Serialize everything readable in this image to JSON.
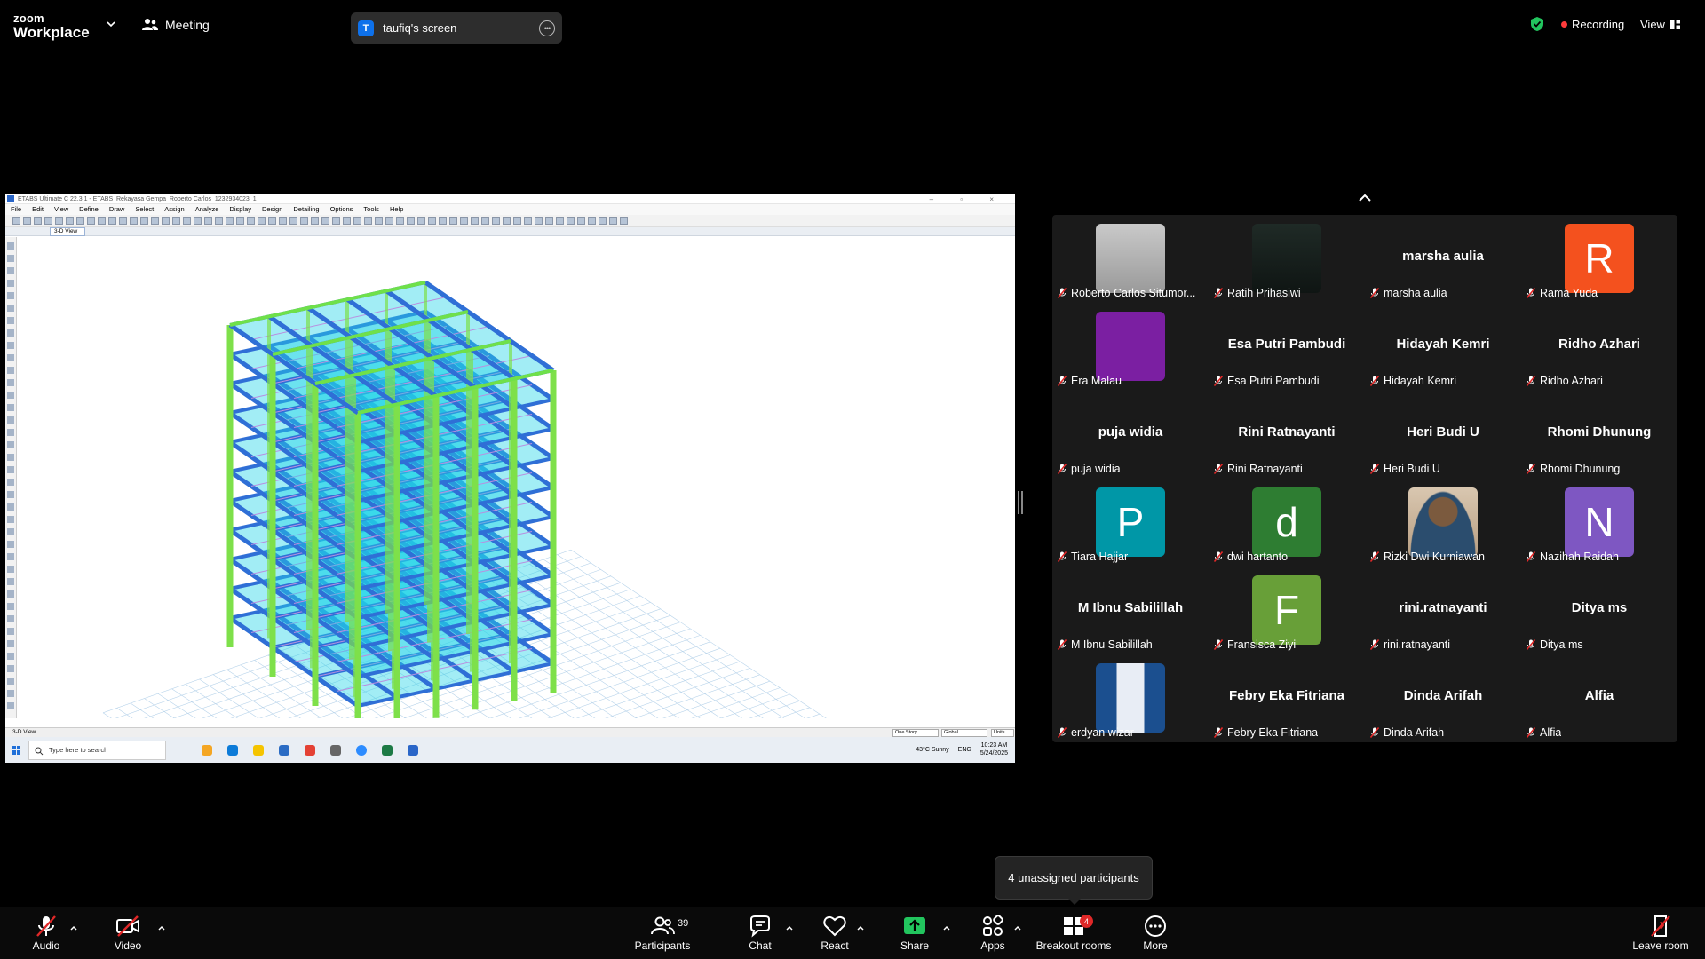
{
  "app": {
    "brand_top": "zoom",
    "brand_bottom": "Workplace",
    "meeting_label": "Meeting",
    "screen_share_initial": "T",
    "screen_share_label": "taufiq's screen",
    "recording_label": "Recording",
    "view_label": "View",
    "colors": {
      "accent": "#0e71eb",
      "recording_dot": "#ff3b3b",
      "shield": "#22c55e",
      "share_green": "#22c55e",
      "badge": "#e02828"
    }
  },
  "shared_screen": {
    "window_title": "ETABS Ultimate C 22.3.1 - ETABS_Rekayasa Gempa_Roberto Carlos_1232934023_1",
    "menu": [
      "File",
      "Edit",
      "View",
      "Define",
      "Draw",
      "Select",
      "Assign",
      "Analyze",
      "Display",
      "Design",
      "Detailing",
      "Options",
      "Tools",
      "Help"
    ],
    "view_tab": "3-D View",
    "status_left": "3-D View",
    "status_story": "One Story",
    "status_global": "Global",
    "status_units": "Units",
    "taskbar_search": "Type here to search",
    "weather": "43°C  Sunny",
    "lang": "ENG",
    "time": "10:23 AM",
    "date": "5/24/2025"
  },
  "participants": [
    {
      "name": "Roberto Carlos Situmor...",
      "big": "",
      "avatar": "photo-gray"
    },
    {
      "name": "Ratih Prihasiwi",
      "big": "",
      "avatar": "photo-dark"
    },
    {
      "name": "marsha aulia",
      "big": "marsha aulia",
      "avatar": ""
    },
    {
      "name": "Rama Yuda",
      "big": "R",
      "avatar": "#f4511e"
    },
    {
      "name": "Era Malau",
      "big": "",
      "avatar": "#7b1fa2"
    },
    {
      "name": "Esa Putri Pambudi",
      "big": "Esa Putri Pambudi",
      "avatar": ""
    },
    {
      "name": "Hidayah Kemri",
      "big": "Hidayah Kemri",
      "avatar": ""
    },
    {
      "name": "Ridho Azhari",
      "big": "Ridho Azhari",
      "avatar": ""
    },
    {
      "name": "puja widia",
      "big": "puja widia",
      "avatar": ""
    },
    {
      "name": "Rini Ratnayanti",
      "big": "Rini Ratnayanti",
      "avatar": ""
    },
    {
      "name": "Heri Budi U",
      "big": "Heri Budi U",
      "avatar": ""
    },
    {
      "name": "Rhomi Dhunung",
      "big": "Rhomi Dhunung",
      "avatar": ""
    },
    {
      "name": "Tiara Hajjar",
      "big": "P",
      "avatar": "#0097a7"
    },
    {
      "name": "dwi hartanto",
      "big": "d",
      "avatar": "#2e7d32"
    },
    {
      "name": "Rizki Dwi Kurniawan",
      "big": "",
      "avatar": "photo-person"
    },
    {
      "name": "Nazihah Raidah",
      "big": "N",
      "avatar": "#7e57c2"
    },
    {
      "name": "M Ibnu Sabilillah",
      "big": "M Ibnu Sabilillah",
      "avatar": ""
    },
    {
      "name": "Fransisca Ziyi",
      "big": "F",
      "avatar": "#689f38"
    },
    {
      "name": "rini.ratnayanti",
      "big": "rini.ratnayanti",
      "avatar": ""
    },
    {
      "name": "Ditya ms",
      "big": "Ditya ms",
      "avatar": ""
    },
    {
      "name": "erdyan wizar",
      "big": "",
      "avatar": "photo-building"
    },
    {
      "name": "Febry Eka Fitriana",
      "big": "Febry Eka Fitriana",
      "avatar": ""
    },
    {
      "name": "Dinda Arifah",
      "big": "Dinda Arifah",
      "avatar": ""
    },
    {
      "name": "Alfia",
      "big": "Alfia",
      "avatar": ""
    }
  ],
  "tooltip": "4 unassigned participants",
  "toolbar": {
    "audio": "Audio",
    "video": "Video",
    "participants": "Participants",
    "participants_count": "39",
    "chat": "Chat",
    "react": "React",
    "share": "Share",
    "apps": "Apps",
    "breakout": "Breakout rooms",
    "breakout_badge": "4",
    "more": "More",
    "leave": "Leave room"
  }
}
